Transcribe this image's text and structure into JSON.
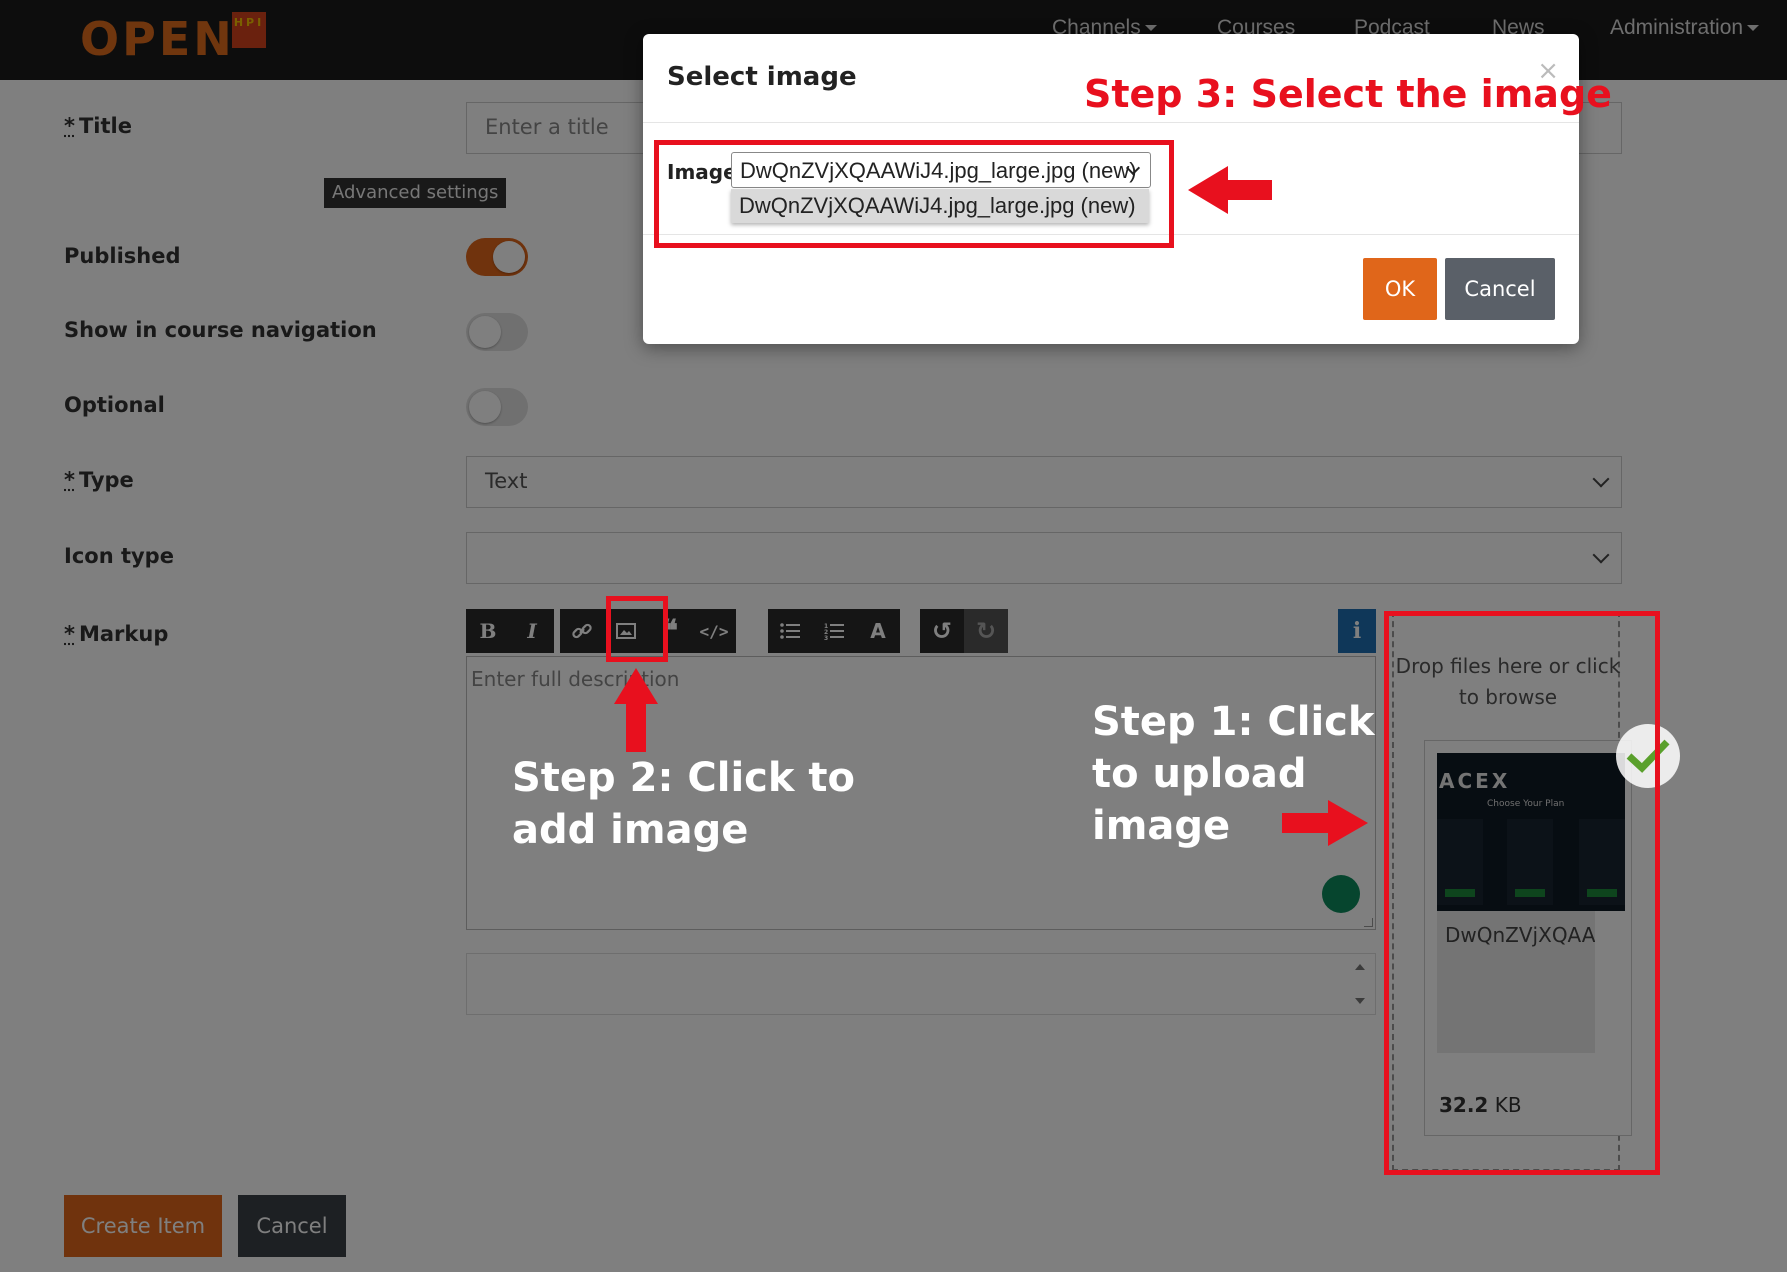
{
  "navbar": {
    "logo_text": "OPEN",
    "logo_badge": "HPI",
    "items": [
      {
        "label": "Channels"
      },
      {
        "label": "Courses"
      },
      {
        "label": "Podcast"
      },
      {
        "label": "News"
      },
      {
        "label": "Administration"
      }
    ]
  },
  "form": {
    "title_label": "Title",
    "title_placeholder": "Enter a title",
    "advanced_settings": "Advanced settings",
    "published_label": "Published",
    "published_value": true,
    "show_nav_label": "Show in course navigation",
    "show_nav_value": false,
    "optional_label": "Optional",
    "optional_value": false,
    "type_label": "Type",
    "type_value": "Text",
    "icon_type_label": "Icon type",
    "icon_type_value": "",
    "markup_label": "Markup",
    "markup_placeholder": "Enter full description",
    "required_marker": "*"
  },
  "toolbar": {
    "buttons": [
      "bold-icon",
      "italic-icon",
      "link-icon",
      "image-icon",
      "quote-icon",
      "code-icon",
      "unordered-list-icon",
      "ordered-list-icon",
      "heading-icon",
      "undo-icon",
      "redo-icon"
    ],
    "info_label": "i"
  },
  "dropzone": {
    "text": "Drop files here or click to browse",
    "file": {
      "name": "DwQnZVjXQAA",
      "size_value": "32.2",
      "size_unit": "KB",
      "thumb_brand": "ACEX",
      "thumb_heading": "Choose Your Plan"
    }
  },
  "actions": {
    "create_label": "Create Item",
    "cancel_label": "Cancel"
  },
  "modal": {
    "title": "Select image",
    "close_label": "×",
    "image_label": "Image",
    "selected_value": "DwQnZVjXQAAWiJ4.jpg_large.jpg (new)",
    "options": [
      "DwQnZVjXQAAWiJ4.jpg_large.jpg (new)"
    ],
    "ok_label": "OK",
    "cancel_label": "Cancel"
  },
  "annotations": {
    "step1": "Step 1: Click to upload image",
    "step2": "Step 2: Click to add image",
    "step3": "Step 3: Select the image"
  },
  "colors": {
    "accent": "#e0661a",
    "annotation_red": "#e8101e",
    "navbar_bg": "#1a1a1a"
  }
}
